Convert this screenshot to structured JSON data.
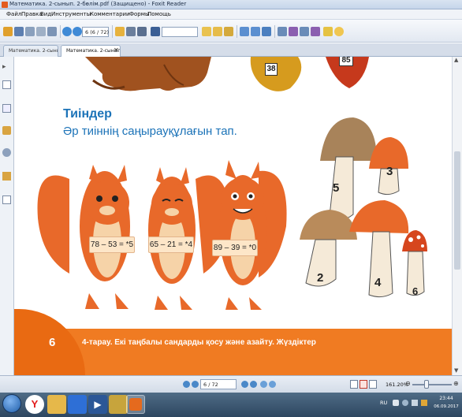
{
  "window": {
    "title": "Математика. 2-сынып. 2-бөлім.pdf (Защищено) - Foxit Reader"
  },
  "menu": [
    "Файл",
    "Правка",
    "Вид",
    "Инструменты",
    "Комментарии",
    "Формы",
    "Помощь"
  ],
  "toolbar": {
    "page_field": "6 (6 / 72)"
  },
  "tabs": [
    {
      "label": "Математика. 2-сынып. ..."
    },
    {
      "label": "Математика. 2-сынып. ..."
    }
  ],
  "page": {
    "leaf_numbers": [
      "38",
      "85"
    ],
    "section_title": "Тиіндер",
    "instruction": "Әр тиіннің саңырауқұлағын тап.",
    "equations": [
      "78 – 53 = *5",
      "65 – 21 = *4",
      "89 – 39 = *0"
    ],
    "mushroom_numbers": [
      "5",
      "3",
      "2",
      "4",
      "6"
    ],
    "page_number": "6",
    "chapter_text": "4-тарау. Екі таңбалы сандарды қосу және азайту. Жүздіктер"
  },
  "statusbar": {
    "page_field": "6 / 72",
    "zoom": "161.20%"
  },
  "taskbar": {
    "language": "RU",
    "time": "23:44",
    "date": "06.09.2017"
  },
  "colors": {
    "accent_blue": "#1c73b8",
    "orange_band": "#f07b22",
    "squirrel": "#e8692a"
  }
}
